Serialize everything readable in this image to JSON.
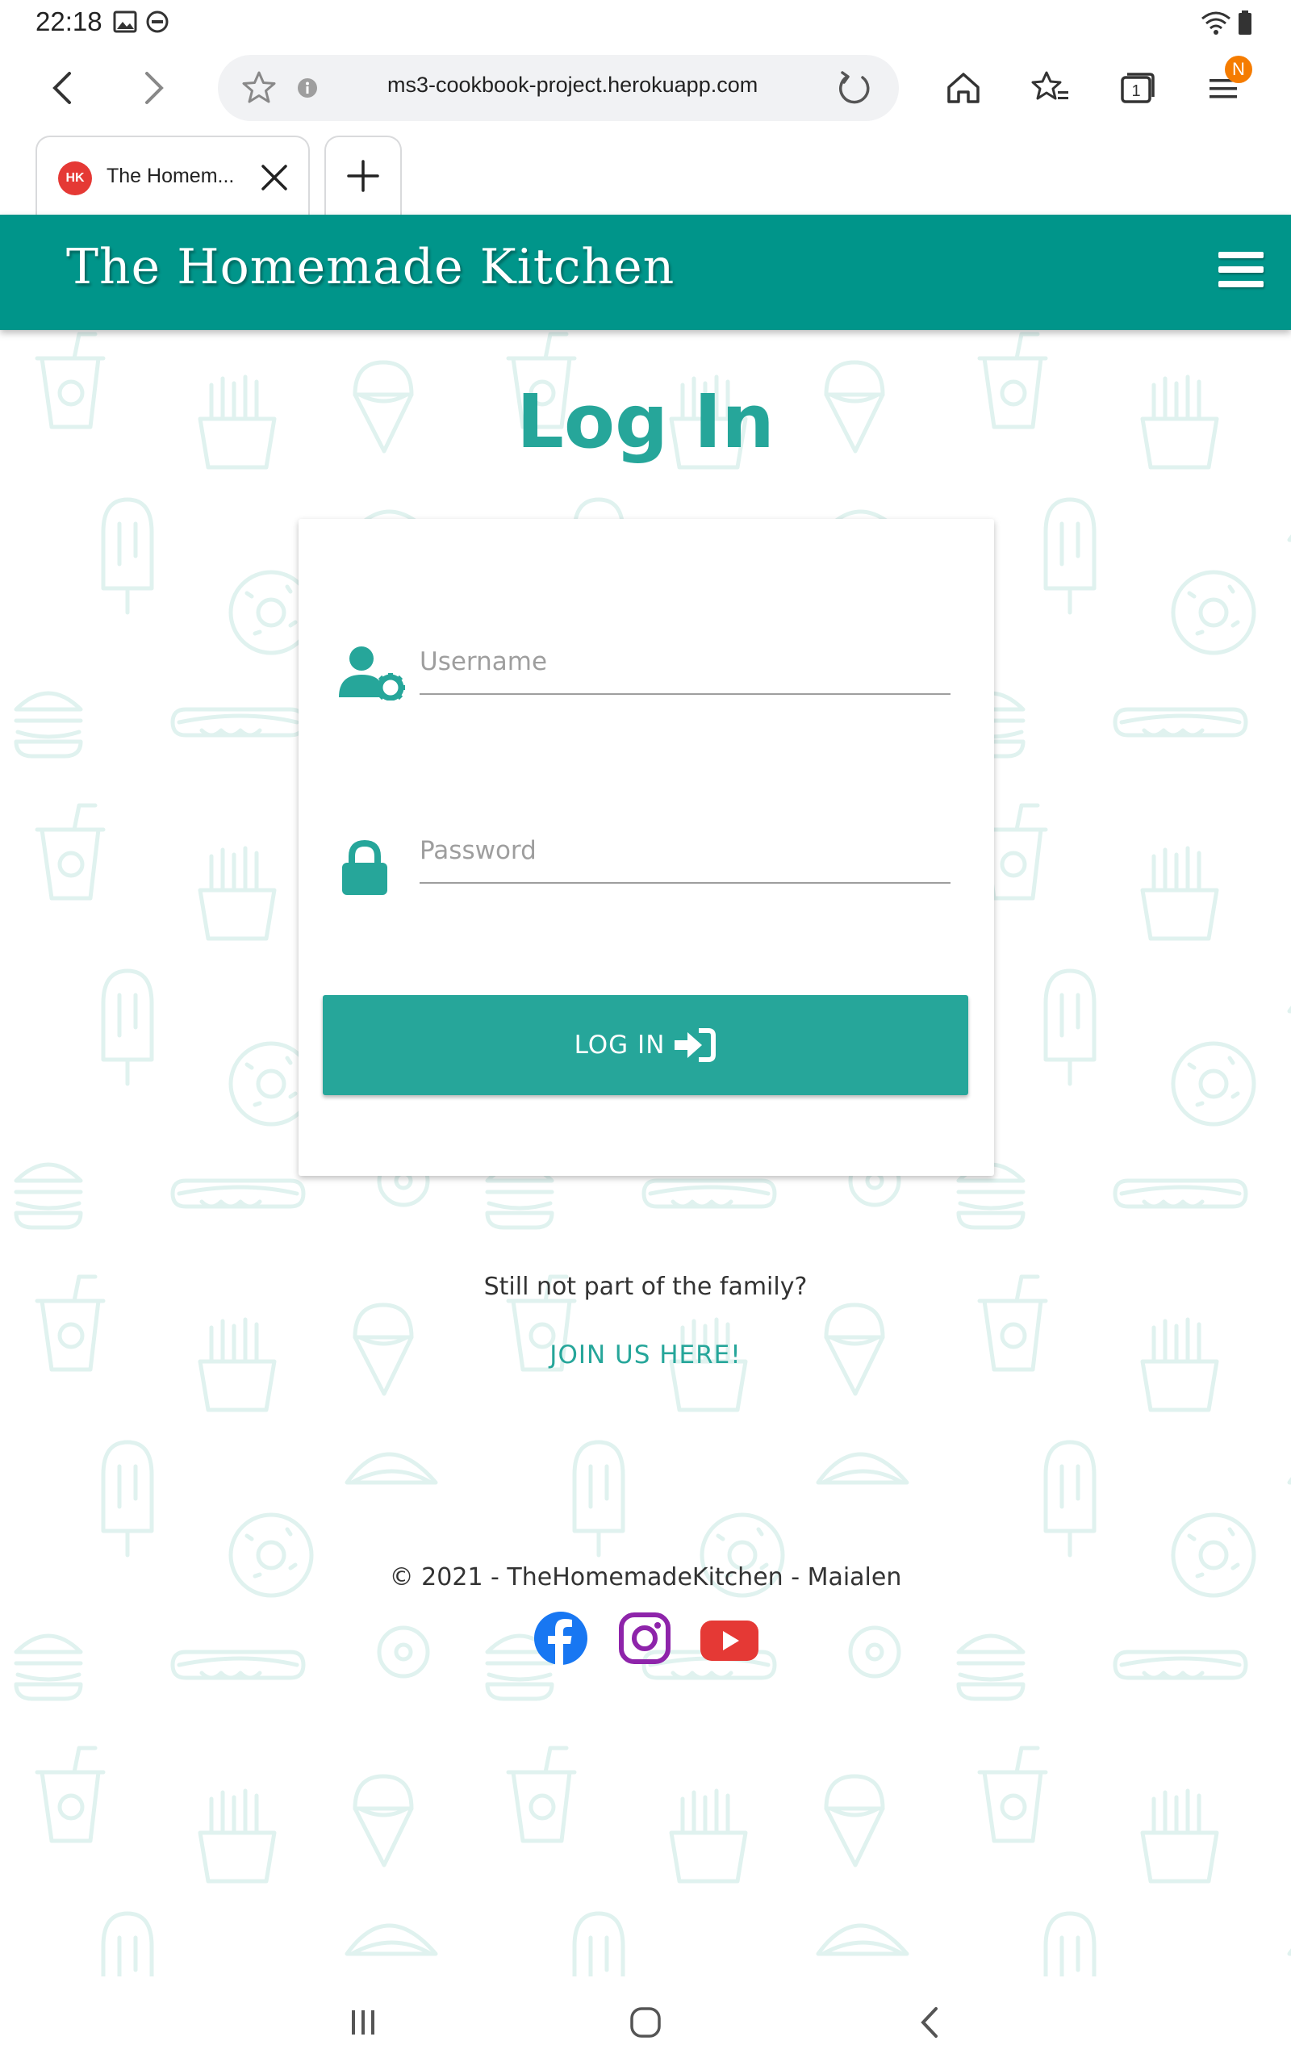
{
  "status_bar": {
    "time": "22:18"
  },
  "browser": {
    "url": "ms3-cookbook-project.herokuapp.com",
    "tab_count": "1",
    "menu_badge": "N",
    "tab": {
      "title": "The Homem...",
      "favicon_text": "HK"
    }
  },
  "header": {
    "brand": "The Homemade Kitchen"
  },
  "page": {
    "title": "Log In"
  },
  "form": {
    "username_placeholder": "Username",
    "password_placeholder": "Password",
    "submit_label": "LOG IN"
  },
  "join": {
    "question": "Still not part of the family?",
    "link_label": "JOIN US HERE!"
  },
  "footer": {
    "copyright": "© 2021 - TheHomemadeKitchen - Maialen",
    "socials": [
      "facebook-icon",
      "instagram-icon",
      "youtube-icon"
    ]
  },
  "colors": {
    "brand_teal": "#00958a",
    "accent_teal": "#26a69a",
    "facebook": "#1877f2",
    "instagram": "#8e24aa",
    "youtube": "#e53935"
  }
}
